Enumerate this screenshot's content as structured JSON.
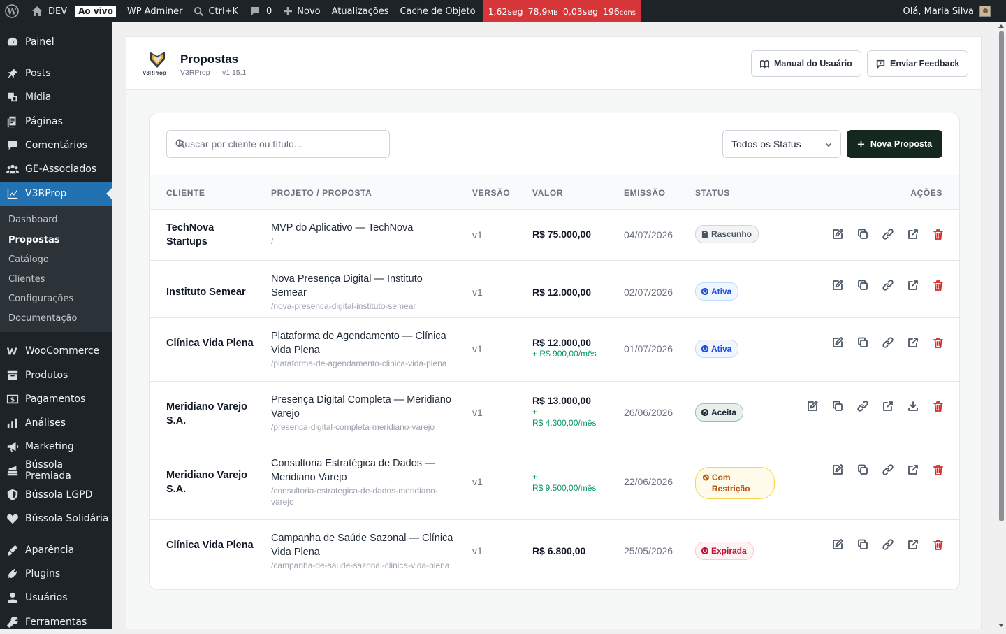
{
  "adminbar": {
    "site_name": "DEV",
    "live_badge": "Ao vivo",
    "adminer": "WP Adminer",
    "shortcut": "Ctrl+K",
    "comments_count": "0",
    "new_label": "Novo",
    "updates": "Atualizações",
    "cache": "Cache de Objeto",
    "perf": {
      "time": "1,62seg",
      "mem": "78,9",
      "mem_unit": "MB",
      "query_time": "0,03seg",
      "queries": "196",
      "queries_unit": "cons"
    },
    "greeting": "Olá, Maria Silva"
  },
  "sidebar": {
    "items": [
      {
        "label": "Painel",
        "icon": "dashboard-icon"
      },
      {
        "label": "Posts",
        "icon": "pin-icon"
      },
      {
        "label": "Mídia",
        "icon": "media-icon"
      },
      {
        "label": "Páginas",
        "icon": "pages-icon"
      },
      {
        "label": "Comentários",
        "icon": "comment-icon"
      },
      {
        "label": "GE-Associados",
        "icon": "groups-icon"
      },
      {
        "label": "V3RProp",
        "icon": "chart-icon"
      },
      {
        "label": "WooCommerce",
        "icon": "woo-icon"
      },
      {
        "label": "Produtos",
        "icon": "archive-icon"
      },
      {
        "label": "Pagamentos",
        "icon": "money-icon"
      },
      {
        "label": "Análises",
        "icon": "bar-chart-icon"
      },
      {
        "label": "Marketing",
        "icon": "megaphone-icon"
      },
      {
        "label": "Bússola Premiada",
        "icon": "stack-icon"
      },
      {
        "label": "Bússola LGPD",
        "icon": "shield-icon"
      },
      {
        "label": "Bússola Solidária",
        "icon": "heart-icon"
      },
      {
        "label": "Aparência",
        "icon": "brush-icon"
      },
      {
        "label": "Plugins",
        "icon": "plug-icon"
      },
      {
        "label": "Usuários",
        "icon": "user-icon"
      },
      {
        "label": "Ferramentas",
        "icon": "wrench-icon"
      }
    ],
    "submenu": [
      "Dashboard",
      "Propostas",
      "Catálogo",
      "Clientes",
      "Configurações",
      "Documentação"
    ]
  },
  "header": {
    "title": "Propostas",
    "plugin": "V3RProp",
    "separator": "·",
    "version": "v1.15.1",
    "manual_btn": "Manual do Usuário",
    "feedback_btn": "Enviar Feedback",
    "logo_text": "V3RProp"
  },
  "toolbar": {
    "search_placeholder": "Buscar por cliente ou título...",
    "status_selected": "Todos os Status",
    "new_btn": "Nova Proposta"
  },
  "table": {
    "headers": [
      "CLIENTE",
      "PROJETO / PROPOSTA",
      "VERSÃO",
      "VALOR",
      "EMISSÃO",
      "STATUS",
      "AÇÕES"
    ],
    "rows": [
      {
        "client": "TechNova Startups",
        "project": "MVP do Aplicativo — TechNova",
        "slug": "/",
        "version": "v1",
        "value": "R$ 75.000,00",
        "recurring_plus": "",
        "recurring": "",
        "date": "04/07/2026",
        "status": "Rascunho",
        "status_kind": "draft"
      },
      {
        "client": "Instituto Semear",
        "project": "Nova Presença Digital — Instituto Semear",
        "slug": "/nova-presenca-digital-instituto-semear",
        "version": "v1",
        "value": "R$ 12.000,00",
        "recurring_plus": "",
        "recurring": "",
        "date": "02/07/2026",
        "status": "Ativa",
        "status_kind": "active"
      },
      {
        "client": "Clínica Vida Plena",
        "project": "Plataforma de Agendamento — Clínica Vida Plena",
        "slug": "/plataforma-de-agendamento-clinica-vida-plena",
        "version": "v1",
        "value": "R$ 12.000,00",
        "recurring_plus": "",
        "recurring": "+ R$ 900,00/mês",
        "date": "01/07/2026",
        "status": "Ativa",
        "status_kind": "active"
      },
      {
        "client": "Meridiano Varejo S.A.",
        "project": "Presença Digital Completa — Meridiano Varejo",
        "slug": "/presenca-digital-completa-meridiano-varejo",
        "version": "v1",
        "value": "R$ 13.000,00",
        "recurring_plus": "+",
        "recurring": "R$ 4.300,00/mês",
        "date": "26/06/2026",
        "status": "Aceita",
        "status_kind": "accepted"
      },
      {
        "client": "Meridiano Varejo S.A.",
        "project": "Consultoria Estratégica de Dados — Meridiano Varejo",
        "slug": "/consultoria-estrategica-de-dados-meridiano-varejo",
        "version": "v1",
        "value": "",
        "recurring_plus": "+",
        "recurring": "R$ 9.500,00/mês",
        "date": "22/06/2026",
        "status": "Com Restrição",
        "status_kind": "restrict"
      },
      {
        "client": "Clínica Vida Plena",
        "project": "Campanha de Saúde Sazonal — Clínica Vida Plena",
        "slug": "/campanha-de-saude-sazonal-clinica-vida-plena",
        "version": "v1",
        "value": "R$ 6.800,00",
        "recurring_plus": "",
        "recurring": "",
        "date": "25/05/2026",
        "status": "Expirada",
        "status_kind": "expired"
      }
    ]
  },
  "colors": {
    "wp_blue": "#2271b1",
    "primary_button": "#14281d",
    "delete": "#dc2626",
    "recurring": "#059669"
  }
}
